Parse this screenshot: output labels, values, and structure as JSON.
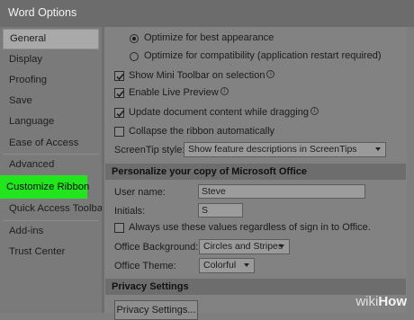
{
  "window": {
    "title": "Word Options"
  },
  "sidebar": {
    "items": [
      {
        "label": "General"
      },
      {
        "label": "Display"
      },
      {
        "label": "Proofing"
      },
      {
        "label": "Save"
      },
      {
        "label": "Language"
      },
      {
        "label": "Ease of Access"
      },
      {
        "label": "Advanced"
      },
      {
        "label": "Customize Ribbon"
      },
      {
        "label": "Quick Access Toolbar"
      },
      {
        "label": "Add-ins"
      },
      {
        "label": "Trust Center"
      }
    ],
    "selected": "General",
    "highlighted": "Customize Ribbon",
    "highlight_color": "#22e51e"
  },
  "ui_options": {
    "radio_best_appearance": "Optimize for best appearance",
    "radio_compatibility": "Optimize for compatibility (application restart required)",
    "show_mini_toolbar": "Show Mini Toolbar on selection",
    "enable_live_preview": "Enable Live Preview",
    "update_while_dragging": "Update document content while dragging",
    "collapse_ribbon": "Collapse the ribbon automatically",
    "screentip_label": "ScreenTip style:",
    "screentip_value": "Show feature descriptions in ScreenTips"
  },
  "personalize": {
    "heading": "Personalize your copy of Microsoft Office",
    "user_name_label": "User name:",
    "user_name_value": "Steve",
    "initials_label": "Initials:",
    "initials_value": "S",
    "always_use_label": "Always use these values regardless of sign in to Office.",
    "background_label": "Office Background:",
    "background_value": "Circles and Stripes",
    "theme_label": "Office Theme:",
    "theme_value": "Colorful"
  },
  "privacy": {
    "heading": "Privacy Settings",
    "button_label": "Privacy Settings..."
  },
  "watermark": {
    "part1": "wiki",
    "part2": "How"
  }
}
